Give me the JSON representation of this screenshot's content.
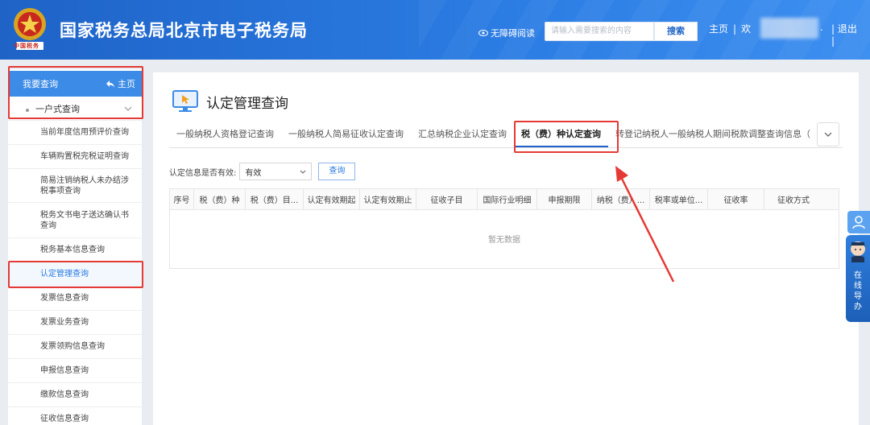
{
  "header": {
    "site_title": "国家税务总局北京市电子税务局",
    "emblem_text": "中国税务",
    "accessibility_label": "无障碍阅读",
    "search_placeholder": "请输入需要搜索的内容",
    "search_button": "搜索",
    "home_link": "主页",
    "welcome_text": "欢",
    "dot_text": ".",
    "logout": "退出",
    "logout_bar": "|",
    "colors": {
      "banner": "#2a7be2",
      "accent": "#1f63c7"
    }
  },
  "sidebar": {
    "header_label": "我要查询",
    "home_label": "主页",
    "group_label": "一户式查询",
    "items": [
      {
        "label": "当前年度信用预评价查询"
      },
      {
        "label": "车辆购置税完税证明查询"
      },
      {
        "label": "简易注销纳税人未办结涉税事项查询"
      },
      {
        "label": "税务文书电子送达确认书查询"
      },
      {
        "label": "税务基本信息查询"
      },
      {
        "label": "认定管理查询",
        "active": true
      },
      {
        "label": "发票信息查询"
      },
      {
        "label": "发票业务查询"
      },
      {
        "label": "发票领购信息查询"
      },
      {
        "label": "申报信息查询"
      },
      {
        "label": "缴款信息查询"
      },
      {
        "label": "征收信息查询"
      }
    ]
  },
  "main": {
    "title": "认定管理查询",
    "tabs": [
      {
        "label": "一般纳税人资格登记查询"
      },
      {
        "label": "一般纳税人简易征收认定查询"
      },
      {
        "label": "汇总纳税企业认定查询"
      },
      {
        "label": "税（费）种认定查询",
        "active": true
      },
      {
        "label": "转登记纳税人一般纳税人期间税款调整查询信息（"
      }
    ],
    "filter": {
      "label": "认定信息是否有效:",
      "value": "有效",
      "query_button": "查询"
    },
    "table": {
      "columns": [
        "序号",
        "税（费）种",
        "税（费）目...",
        "认定有效期起",
        "认定有效期止",
        "征收子目",
        "国际行业明细",
        "申报期限",
        "纳税（费）...",
        "税率或单位...",
        "征收率",
        "征收方式"
      ],
      "empty_text": "暂无数据"
    }
  },
  "float_guide": {
    "label": "在线导办"
  }
}
